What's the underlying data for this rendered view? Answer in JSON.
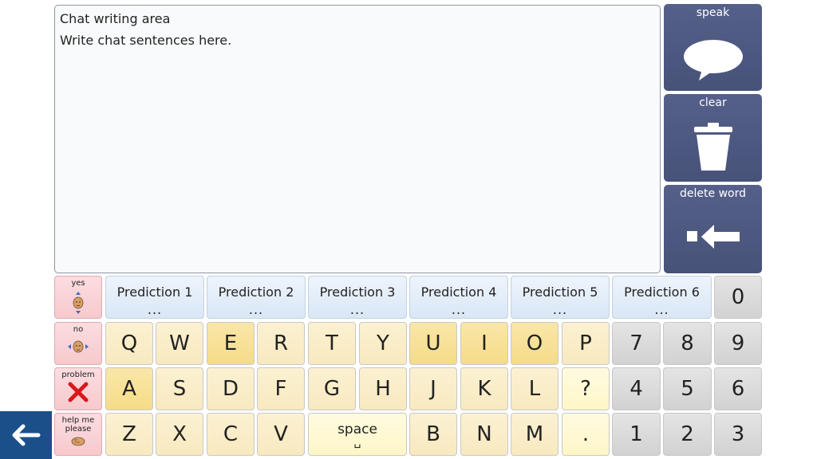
{
  "chat": {
    "title": "Chat writing area",
    "placeholder": "Write chat sentences here."
  },
  "side": {
    "speak": "speak",
    "clear": "clear",
    "delete_word": "delete word"
  },
  "quick": {
    "yes": "yes",
    "no": "no",
    "problem": "problem",
    "help": "help me please"
  },
  "predictions": [
    {
      "label": "Prediction 1",
      "value": "..."
    },
    {
      "label": "Prediction 2",
      "value": "..."
    },
    {
      "label": "Prediction 3",
      "value": "..."
    },
    {
      "label": "Prediction 4",
      "value": "..."
    },
    {
      "label": "Prediction 5",
      "value": "..."
    },
    {
      "label": "Prediction 6",
      "value": "..."
    }
  ],
  "keys": {
    "row1": [
      "Q",
      "W",
      "E",
      "R",
      "T",
      "Y",
      "U",
      "I",
      "O",
      "P"
    ],
    "row2": [
      "A",
      "S",
      "D",
      "F",
      "G",
      "H",
      "J",
      "K",
      "L",
      "?"
    ],
    "row3": [
      "Z",
      "X",
      "C",
      "V",
      "B",
      "N",
      "M",
      "."
    ],
    "space": "space",
    "space_symbol": "␣"
  },
  "numbers": [
    "0",
    "7",
    "8",
    "9",
    "4",
    "5",
    "6",
    "1",
    "2",
    "3"
  ],
  "colors": {
    "side_button": "#4b5680",
    "back_button": "#1b4f8a",
    "quick_bg": "#f8cfd3"
  },
  "icons": {
    "speak": "speech-bubble-icon",
    "clear": "trash-icon",
    "delete": "backspace-icon",
    "back": "arrow-left-icon"
  }
}
